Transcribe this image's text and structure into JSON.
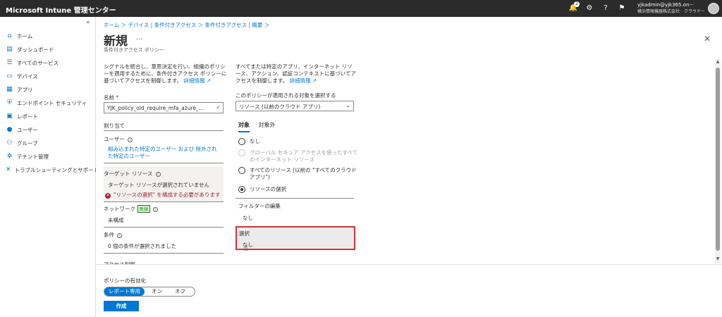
{
  "topbar": {
    "brand": "Microsoft Intune 管理センター",
    "notification_count": "2",
    "account_user": "yjkadmin@yjk365.on···",
    "account_org": "横浜情報機器株式会社　クラウドー"
  },
  "sidebar": {
    "collapse_glyph": "«",
    "items": [
      {
        "label": "ホーム",
        "icon": "home-icon"
      },
      {
        "label": "ダッシュボード",
        "icon": "dashboard-icon"
      },
      {
        "label": "すべてのサービス",
        "icon": "list-icon"
      },
      {
        "label": "デバイス",
        "icon": "device-icon"
      },
      {
        "label": "アプリ",
        "icon": "apps-grid-icon"
      },
      {
        "label": "エンドポイント セキュリティ",
        "icon": "shield-icon"
      },
      {
        "label": "レポート",
        "icon": "report-monitor-icon"
      },
      {
        "label": "ユーザー",
        "icon": "user-icon"
      },
      {
        "label": "グループ",
        "icon": "group-icon"
      },
      {
        "label": "テナント管理",
        "icon": "tenant-icon"
      },
      {
        "label": "トラブルシューティングとサポート",
        "icon": "wrench-icon"
      }
    ]
  },
  "breadcrumb": "ホーム ＞ デバイス | 条件付きアクセス ＞ 条件付きアクセス | 概要 ＞",
  "page": {
    "title": "新規",
    "more": "...",
    "subtitle": "条件付きアクセス ポリシー"
  },
  "left": {
    "description": "シグナルを統合し、意思決定を行い、組織のポリシーを適用するために、条件付きアクセス ポリシーに基づいてアクセスを制御します。",
    "learn_more": "詳細情報",
    "name_label": "名前",
    "name_required": "*",
    "name_value": "YJK_policy_old_require_mfa_azure_...",
    "assignments_heading": "割り当て",
    "users_label": "ユーザー",
    "users_value": "組み込まれた特定のユーザー および 除外された特定のユーザー",
    "target_label": "ターゲット リソース",
    "target_value": "ターゲット リソースが選択されていません",
    "target_error": "\"リソースの選択\" を構成する必要があります",
    "network_label": "ネットワーク",
    "network_badge": "新規",
    "network_value": "未構成",
    "conditions_label": "条件",
    "conditions_value": "0 個の条件が選択されました",
    "access_controls_label": "アクセス制御"
  },
  "right": {
    "description": "すべてまたは特定のアプリ、インターネット リソース、アクション、認証コンテキストに基づいてアクセスを制御します。",
    "learn_more": "詳細情報",
    "applies_label": "このポリシーが適用される対象を選択する",
    "applies_value": "リソース (以前のクラウド アプリ)",
    "tab_include": "対象",
    "tab_exclude": "対象外",
    "radio_none": "なし",
    "radio_global": "グローバル セキュア アクセスを使ったすべてのインターネット リソース",
    "radio_all": "すべてのリソース (以前の \"すべてのクラウド アプリ\")",
    "radio_select": "リソースの選択",
    "filter_label": "フィルターの編集",
    "filter_value": "なし",
    "select_label": "選択",
    "select_value": "なし"
  },
  "footer": {
    "enable_label": "ポリシーの有効化",
    "toggle_report": "レポート専用",
    "toggle_on": "オン",
    "toggle_off": "オフ",
    "create": "作成"
  }
}
